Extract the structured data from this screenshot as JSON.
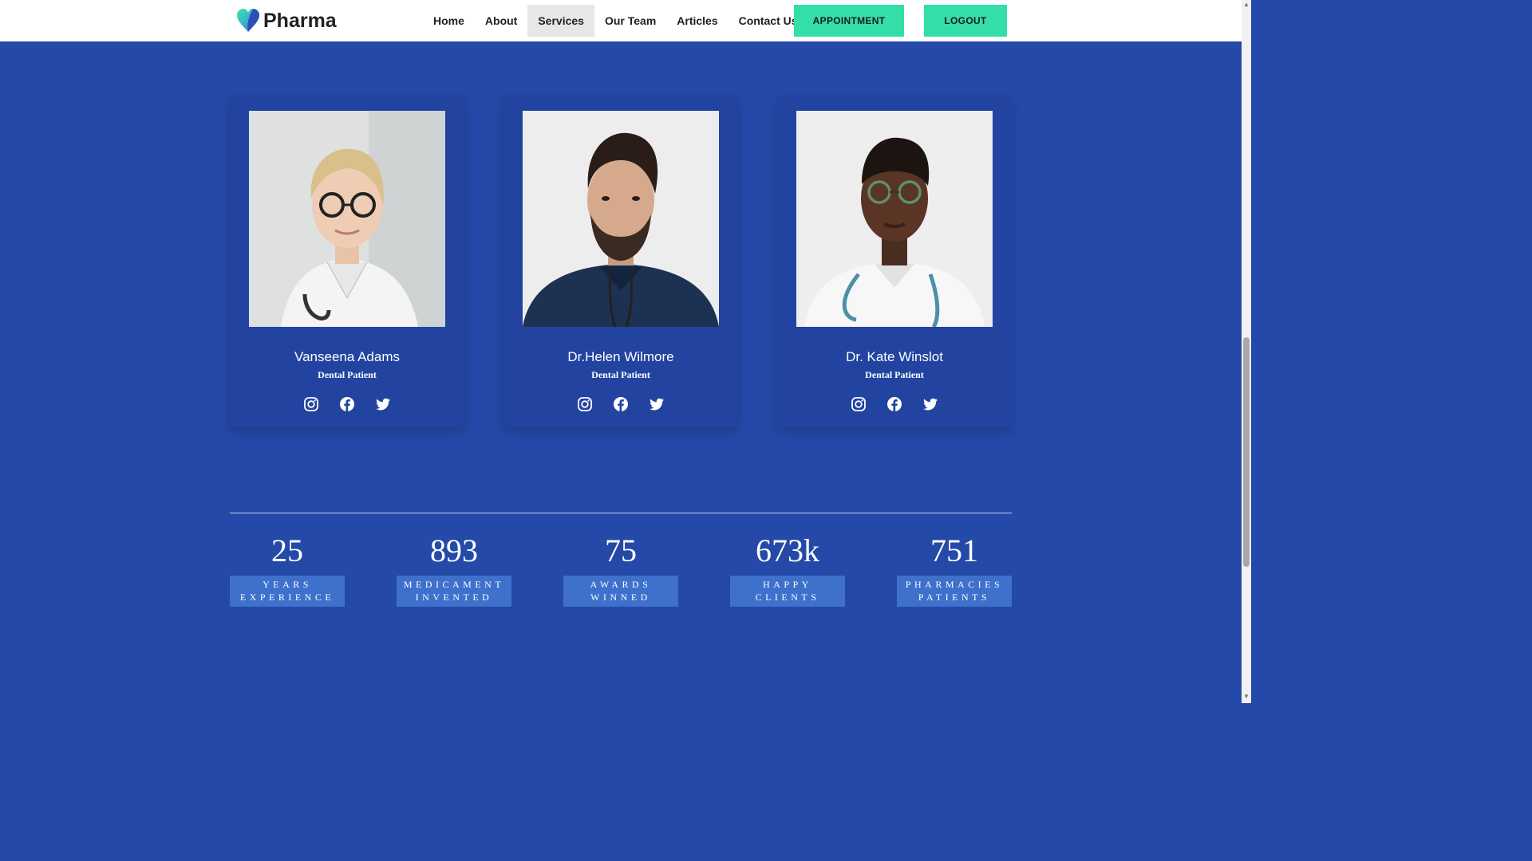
{
  "brand": {
    "name": "Pharma"
  },
  "nav": {
    "links": [
      "Home",
      "About",
      "Services",
      "Our Team",
      "Articles",
      "Contact Us"
    ],
    "active": "Services",
    "appointment_label": "APPOINTMENT",
    "logout_label": "LOGOUT"
  },
  "team": [
    {
      "name": "Vanseena Adams",
      "role": "Dental Patient"
    },
    {
      "name": "Dr.Helen Wilmore",
      "role": "Dental Patient"
    },
    {
      "name": "Dr. Kate Winslot",
      "role": "Dental Patient"
    }
  ],
  "stats": [
    {
      "number": "25",
      "line1": "YEARS",
      "line2": "EXPERIENCE"
    },
    {
      "number": "893",
      "line1": "MEDICAMENT",
      "line2": "INVENTED"
    },
    {
      "number": "75",
      "line1": "AWARDS",
      "line2": "WINNED"
    },
    {
      "number": "673k",
      "line1": "HAPPY",
      "line2": "CLIENTS"
    },
    {
      "number": "751",
      "line1": "PHARMACIES",
      "line2": "PATIENTS"
    }
  ],
  "colors": {
    "background": "#2449a8",
    "card": "#2244a0",
    "accent": "#33dea8",
    "stat_label_bg": "#3e70cc"
  },
  "icons": [
    "instagram-icon",
    "facebook-icon",
    "twitter-icon"
  ]
}
